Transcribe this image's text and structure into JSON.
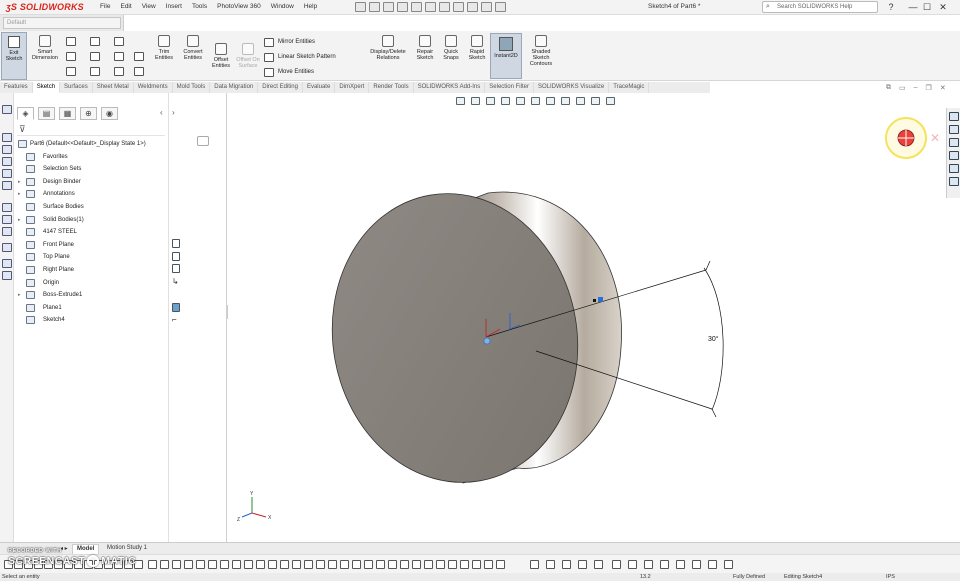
{
  "app": {
    "logo_text": "SOLIDWORKS",
    "document_title": "Sketch4 of Part6 *",
    "menus": [
      "File",
      "Edit",
      "View",
      "Insert",
      "Tools",
      "PhotoView 360",
      "Window",
      "Help"
    ],
    "help_search_placeholder": "Search SOLIDWORKS Help",
    "help_label": "?",
    "minimize": "—",
    "maximize": "☐",
    "close": "✕"
  },
  "config": {
    "current": "Default"
  },
  "ribbon": {
    "exit_sketch": "Exit Sketch",
    "smart_dimension": "Smart Dimension",
    "trim_entities": "Trim Entities",
    "convert_entities": "Convert Entities",
    "offset_entities": "Offset Entities",
    "offset_on_surface": "Offset On Surface",
    "mirror_entities": "Mirror Entities",
    "linear_sketch_pattern": "Linear Sketch Pattern",
    "move_entities": "Move Entities",
    "display_delete_relations": "Display/Delete Relations",
    "repair_sketch": "Repair Sketch",
    "quick_snaps": "Quick Snaps",
    "rapid_sketch": "Rapid Sketch",
    "instant2d": "Instant2D",
    "shaded_sketch_contours": "Shaded Sketch Contours"
  },
  "command_tabs": [
    "Features",
    "Sketch",
    "Surfaces",
    "Sheet Metal",
    "Weldments",
    "Mold Tools",
    "Data Migration",
    "Direct Editing",
    "Evaluate",
    "DimXpert",
    "Render Tools",
    "SOLIDWORKS Add-Ins",
    "Selection Filter",
    "SOLIDWORKS Visualize",
    "TraceMagic"
  ],
  "active_command_tab": "Sketch",
  "feature_tree": {
    "root": "Part6  (Default<<Default>_Display State 1>)",
    "items": [
      {
        "label": "Favorites",
        "expandable": false
      },
      {
        "label": "Selection Sets",
        "expandable": false
      },
      {
        "label": "Design Binder",
        "expandable": true
      },
      {
        "label": "Annotations",
        "expandable": true
      },
      {
        "label": "Surface Bodies",
        "expandable": false
      },
      {
        "label": "Solid Bodies(1)",
        "expandable": true
      },
      {
        "label": "4147 STEEL",
        "expandable": false
      },
      {
        "label": "Front Plane",
        "expandable": false
      },
      {
        "label": "Top Plane",
        "expandable": false
      },
      {
        "label": "Right Plane",
        "expandable": false
      },
      {
        "label": "Origin",
        "expandable": false
      },
      {
        "label": "Boss-Extrude1",
        "expandable": true
      },
      {
        "label": "Plane1",
        "expandable": false
      },
      {
        "label": "Sketch4",
        "expandable": false
      }
    ]
  },
  "viewport": {
    "angle_dimension": "30°",
    "triad_y": "Y",
    "triad_x": "X",
    "triad_z": "Z"
  },
  "bottom_tabs": [
    "Model",
    "Motion Study 1"
  ],
  "active_bottom_tab": "Model",
  "status": {
    "prompt": "Select an entity",
    "coordinate": "13.2",
    "definition_state": "Fully Defined",
    "editing": "Editing Sketch4",
    "units": "IPS"
  },
  "watermark": {
    "line1": "RECORDED WITH",
    "line2a": "SCREENCAST",
    "line2b": "MATIC"
  },
  "colors": {
    "brand_red": "#d9261c",
    "active_button_bg": "#cfd8e2",
    "part_face": "#8a8580"
  }
}
